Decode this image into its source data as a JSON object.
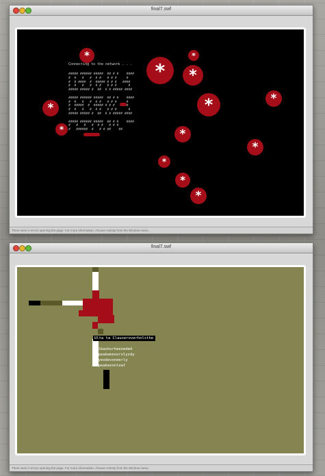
{
  "window_top": {
    "title": "final7.swf",
    "status": "There were 2 errors opening the page. For more information, choose Activity from the Window menu.",
    "stage": {
      "terminal_line": "Connecting to the network . . .",
      "ascii_art": [
        "##### ###### #####  ## # #    ####",
        "#  #   #   #  # #   # # #     #",
        "#  # ####  #  ##### # # #   ####",
        "#  #   #   #  # #   # # #      #",
        "##### ##### #  ##  # # ##### ####",
        "",
        "##### ###### #####  ## # #    ####",
        "#  #   #   #  # #   # # #     #",
        "#  #####  #  ##### # # #   ####",
        "#  #   #   #  # #   # # #      #",
        "##### ##### #  ##  # # ##### ####",
        "",
        "##### ###### #####  ## # #    ####",
        "#   #   #   #  # #   # # #",
        "#   ######  #   # # ##    ##"
      ],
      "blob_glyph": "*"
    }
  },
  "window_bottom": {
    "title": "final7.swf",
    "status": "There were 2 errors opening the page. For more information, choose Activity from the Window menu.",
    "stage": {
      "menu_label": "Ulta ta Clauseroverholsthe",
      "menu_items": [
        "ullbaskorheeneded",
        "ulpeakemnoornlyzdy",
        "llyeodevoneerly",
        "ulpeakeonnleaf"
      ]
    }
  },
  "colors": {
    "blob_red": "#a50e18",
    "olive_bg": "#858552",
    "dark_olive": "#5a5a2a"
  }
}
